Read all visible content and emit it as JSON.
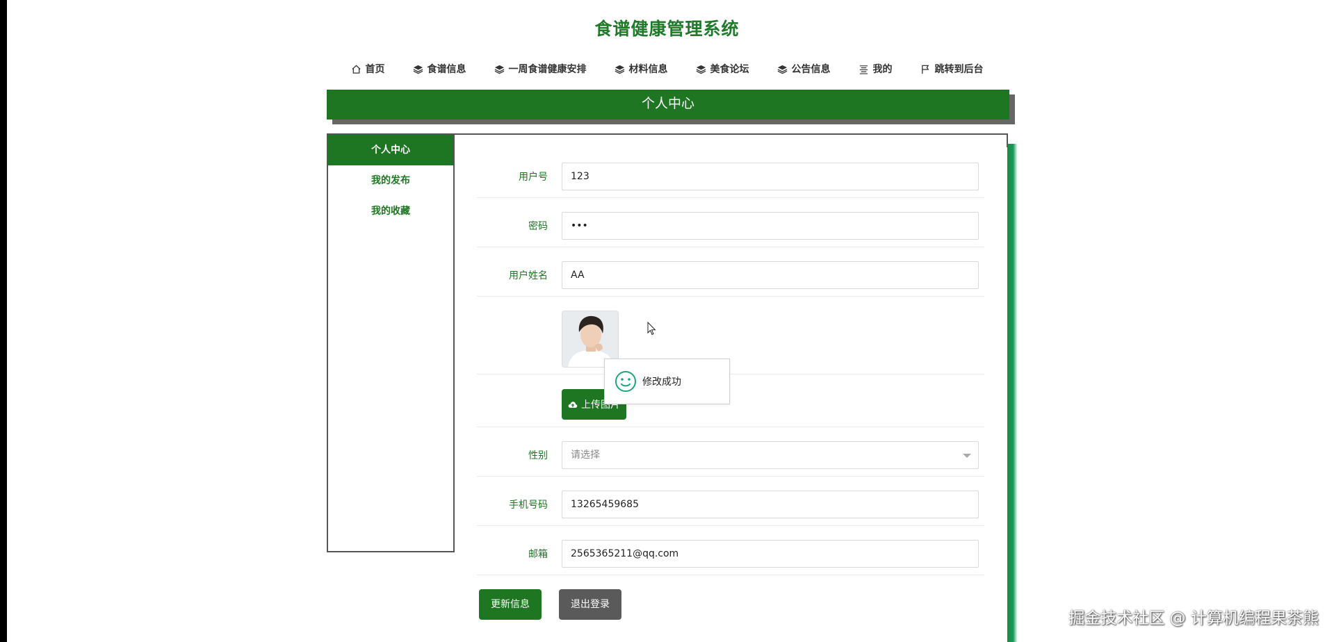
{
  "site": {
    "title": "食谱健康管理系统"
  },
  "nav": {
    "items": [
      {
        "label": "首页",
        "icon": "home-icon"
      },
      {
        "label": "食谱信息",
        "icon": "layers-icon"
      },
      {
        "label": "一周食谱健康安排",
        "icon": "layers-icon"
      },
      {
        "label": "材料信息",
        "icon": "layers-icon"
      },
      {
        "label": "美食论坛",
        "icon": "layers-icon"
      },
      {
        "label": "公告信息",
        "icon": "layers-icon"
      },
      {
        "label": "我的",
        "icon": "menu-icon"
      },
      {
        "label": "跳转到后台",
        "icon": "flag-icon"
      }
    ]
  },
  "banner": {
    "title": "个人中心"
  },
  "sidebar": {
    "items": [
      {
        "label": "个人中心",
        "active": true
      },
      {
        "label": "我的发布",
        "active": false
      },
      {
        "label": "我的收藏",
        "active": false
      }
    ]
  },
  "form": {
    "username": {
      "label": "用户号",
      "value": "123"
    },
    "password": {
      "label": "密码",
      "value": "•••"
    },
    "realname": {
      "label": "用户姓名",
      "value": "AA"
    },
    "upload": {
      "label": "上传图片"
    },
    "gender": {
      "label": "性别",
      "placeholder": "请选择"
    },
    "phone": {
      "label": "手机号码",
      "value": "13265459685"
    },
    "email": {
      "label": "邮箱",
      "value": "2565365211@qq.com"
    }
  },
  "toast": {
    "message": "修改成功"
  },
  "buttons": {
    "update": "更新信息",
    "logout": "退出登录"
  },
  "watermark": "掘金技术社区 @ 计算机编程果茶熊",
  "colors": {
    "primary": "#1e7623",
    "secondary": "#5a5a5a",
    "accent_bar": "#159a5a"
  }
}
